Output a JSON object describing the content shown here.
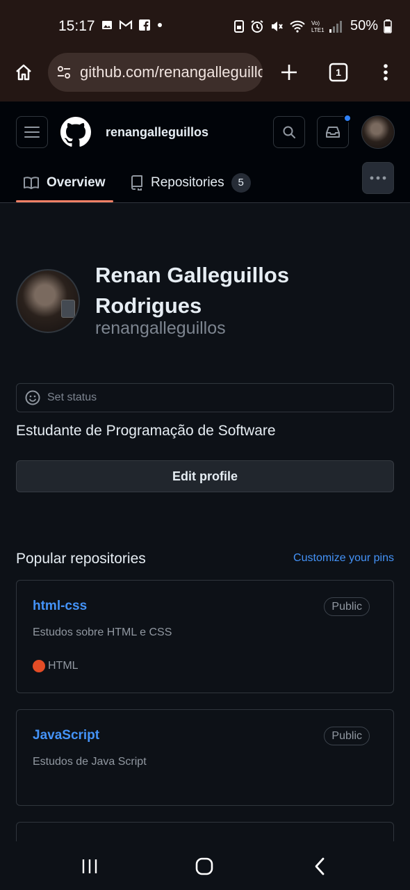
{
  "status_bar": {
    "time": "15:17",
    "battery": "50%",
    "left_icons": [
      "image-icon",
      "gmail-icon",
      "facebook-icon",
      "dot-icon"
    ],
    "right_icons": [
      "lock-sim-icon",
      "alarm-icon",
      "mute-icon",
      "wifi-icon",
      "lte-signal-icon",
      "battery-icon"
    ],
    "volte": "Vo)\nLTE1"
  },
  "browser": {
    "url": "github.com/renangalleguillos",
    "tab_count": "1",
    "icons": [
      "home-icon",
      "site-info-icon",
      "new-tab-icon",
      "tabs-icon",
      "more-vert-icon"
    ]
  },
  "header": {
    "username": "renangalleguillos",
    "icons": [
      "hamburger-menu-icon",
      "github-logo-icon",
      "search-icon",
      "inbox-icon",
      "avatar"
    ],
    "notification_color": "#2f81f7"
  },
  "tabs": [
    {
      "label": "Overview",
      "icon": "book-icon",
      "selected": true
    },
    {
      "label": "Repositories",
      "icon": "repo-icon",
      "count": "5"
    }
  ],
  "profile": {
    "full_name_line1": "Renan Galleguillos",
    "full_name_line2": "Rodrigues",
    "login": "renangalleguillos",
    "set_status_label": "Set status",
    "bio": "Estudante de Programação de Software",
    "edit_button": "Edit profile"
  },
  "popular": {
    "title": "Popular repositories",
    "customize_label": "Customize your pins",
    "repos": [
      {
        "name": "html-css",
        "visibility": "Public",
        "description": "Estudos sobre HTML e CSS",
        "language": "HTML",
        "language_color": "#e34c26"
      },
      {
        "name": "JavaScript",
        "visibility": "Public",
        "description": "Estudos de Java Script"
      }
    ]
  },
  "nav": {
    "icons": [
      "recents-icon",
      "home-circle-icon",
      "back-icon"
    ]
  }
}
